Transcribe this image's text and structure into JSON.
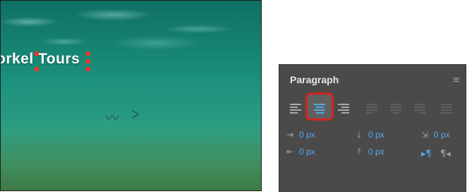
{
  "preview": {
    "title_text": "orkel Tours"
  },
  "panel": {
    "title": "Paragraph",
    "menu_icon": "≡",
    "alignment": {
      "active": "center",
      "buttons": [
        "align-left",
        "align-center",
        "align-right",
        "justify-last-left",
        "justify-last-center",
        "justify-last-right",
        "justify-all"
      ]
    },
    "indent_left": {
      "icon": "indent-left-icon",
      "value": "0 px"
    },
    "space_before": {
      "icon": "space-before-icon",
      "value": "0 px"
    },
    "indent_first_line": {
      "icon": "indent-first-line-icon",
      "value": "0 px"
    },
    "indent_right": {
      "icon": "indent-right-icon",
      "value": "0 px"
    },
    "space_after": {
      "icon": "space-after-icon",
      "value": "0 px"
    },
    "direction": {
      "active": "left-to-right"
    }
  },
  "colors": {
    "accent": "#3b9ce8",
    "highlight": "#d3231e",
    "panel_bg": "#4a4a4a"
  }
}
